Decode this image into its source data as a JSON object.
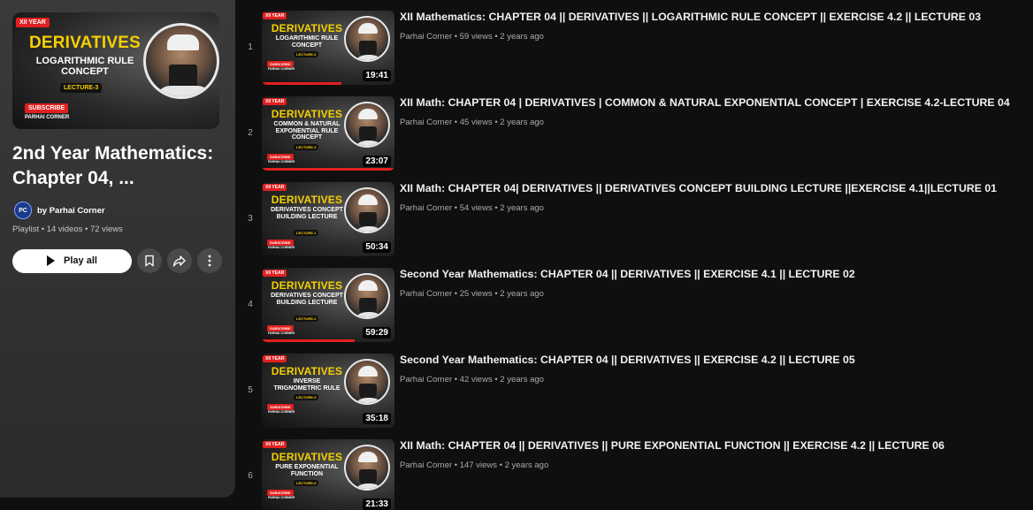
{
  "playlist": {
    "thumb": {
      "year": "XII YEAR",
      "title": "DERIVATIVES",
      "subtitle": "LOGARITHMIC RULE CONCEPT",
      "lecture": "LECTURE-3",
      "subscribe": "SUBSCRIBE",
      "brand": "PARHAI CORNER"
    },
    "title": "2nd Year Mathematics: Chapter 04, ...",
    "owner_initials": "PC",
    "owner": "by Parhai Corner",
    "meta": "Playlist • 14 videos • 72 views",
    "play_all_label": "Play all",
    "icons": [
      "play-icon",
      "save-icon",
      "share-icon",
      "more-icon"
    ]
  },
  "videos": [
    {
      "index": "1",
      "title": "XII Mathematics: CHAPTER 04 || DERIVATIVES || LOGARITHMIC RULE CONCEPT || EXERCISE 4.2 || LECTURE 03",
      "meta": "Parhai Corner • 59 views • 2 years ago",
      "duration": "19:41",
      "watched_fraction": 0.6,
      "thumb": {
        "year": "XII YEAR",
        "title": "DERIVATIVES",
        "subtitle": "LOGARITHMIC RULE CONCEPT",
        "lecture": "LECTURE-3",
        "subscribe": "SUBSCRIBE",
        "brand": "PARHAI CORNER"
      }
    },
    {
      "index": "2",
      "title": "XII Math: CHAPTER 04 | DERIVATIVES | COMMON & NATURAL EXPONENTIAL CONCEPT | EXERCISE 4.2-LECTURE 04",
      "meta": "Parhai Corner • 45 views • 2 years ago",
      "duration": "23:07",
      "watched_fraction": 1.0,
      "thumb": {
        "year": "XII YEAR",
        "title": "DERIVATIVES",
        "subtitle": "COMMON & NATURAL EXPONENTIAL RULE CONCEPT",
        "lecture": "LECTURE-4",
        "subscribe": "SUBSCRIBE",
        "brand": "PARHAI CORNER"
      }
    },
    {
      "index": "3",
      "title": "XII Math: CHAPTER 04| DERIVATIVES || DERIVATIVES CONCEPT BUILDING LECTURE ||EXERCISE 4.1||LECTURE 01",
      "meta": "Parhai Corner • 54 views • 2 years ago",
      "duration": "50:34",
      "watched_fraction": 0.0,
      "thumb": {
        "year": "XII YEAR",
        "title": "DERIVATIVES",
        "subtitle": "DERIVATIVES CONCEPT BUILDING LECTURE",
        "lecture": "LECTURE-1",
        "subscribe": "SUBSCRIBE",
        "brand": "PARHAI CORNER"
      }
    },
    {
      "index": "4",
      "title": "Second Year Mathematics: CHAPTER 04 || DERIVATIVES || EXERCISE 4.1 || LECTURE 02",
      "meta": "Parhai Corner • 25 views • 2 years ago",
      "duration": "59:29",
      "watched_fraction": 0.7,
      "thumb": {
        "year": "XII YEAR",
        "title": "DERIVATIVES",
        "subtitle": "DERIVATIVES CONCEPT BUILDING LECTURE",
        "lecture": "LECTURE-2",
        "subscribe": "SUBSCRIBE",
        "brand": "PARHAI CORNER"
      }
    },
    {
      "index": "5",
      "title": "Second Year Mathematics: CHAPTER 04 || DERIVATIVES || EXERCISE 4.2 || LECTURE 05",
      "meta": "Parhai Corner • 42 views • 2 years ago",
      "duration": "35:18",
      "watched_fraction": 0.0,
      "thumb": {
        "year": "XII YEAR",
        "title": "DERIVATIVES",
        "subtitle": "INVERSE TRIGNOMETRIC RULE",
        "lecture": "LECTURE-5",
        "subscribe": "SUBSCRIBE",
        "brand": "PARHAI CORNER"
      }
    },
    {
      "index": "6",
      "title": "XII Math: CHAPTER 04 || DERIVATIVES || PURE EXPONENTIAL FUNCTION || EXERCISE 4.2 || LECTURE 06",
      "meta": "Parhai Corner • 147 views • 2 years ago",
      "duration": "21:33",
      "watched_fraction": 0.0,
      "thumb": {
        "year": "XII YEAR",
        "title": "DERIVATIVES",
        "subtitle": "PURE EXPONENTIAL FUNCTION",
        "lecture": "LECTURE-6",
        "subscribe": "SUBSCRIBE",
        "brand": "PARHAI CORNER"
      }
    }
  ]
}
